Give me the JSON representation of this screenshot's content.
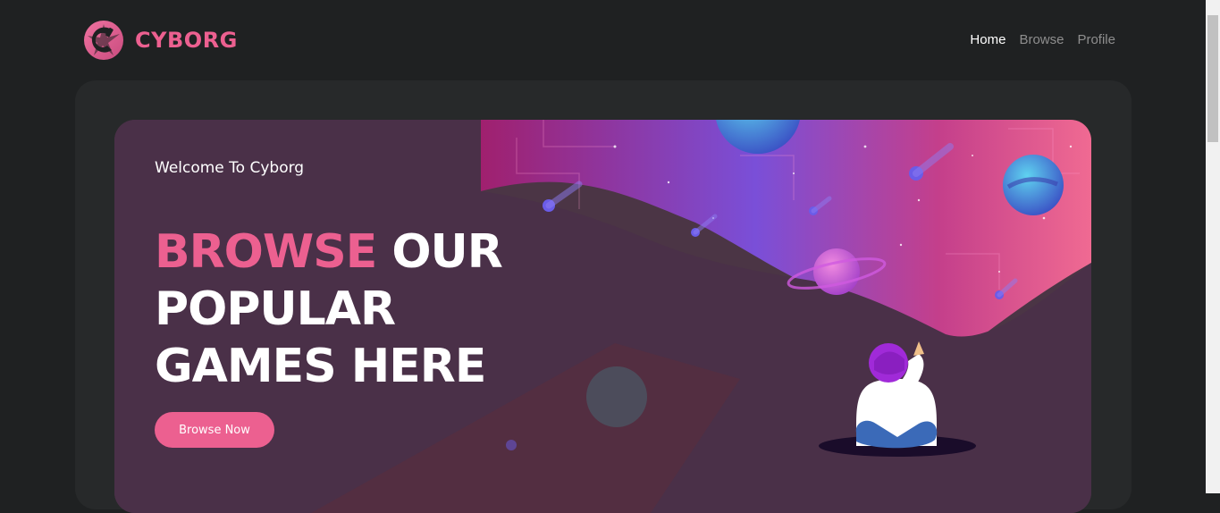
{
  "header": {
    "logo_text": "CYBORG",
    "logo_icon": "cyborg-logo-icon",
    "nav": [
      {
        "label": "Home",
        "active": true
      },
      {
        "label": "Browse",
        "active": false
      },
      {
        "label": "Profile",
        "active": false
      }
    ]
  },
  "banner": {
    "welcome": "Welcome To Cyborg",
    "headline_accent": "BROWSE",
    "headline_rest_1": "OUR",
    "headline_rest_2": "POPULAR",
    "headline_rest_3": "GAMES HERE",
    "button_label": "Browse Now",
    "illustration": "astronaut-space-illustration"
  },
  "colors": {
    "accent": "#ec6090",
    "page_bg": "#1f2122",
    "panel_bg": "#27292a",
    "banner_bg": "#4b3545"
  }
}
